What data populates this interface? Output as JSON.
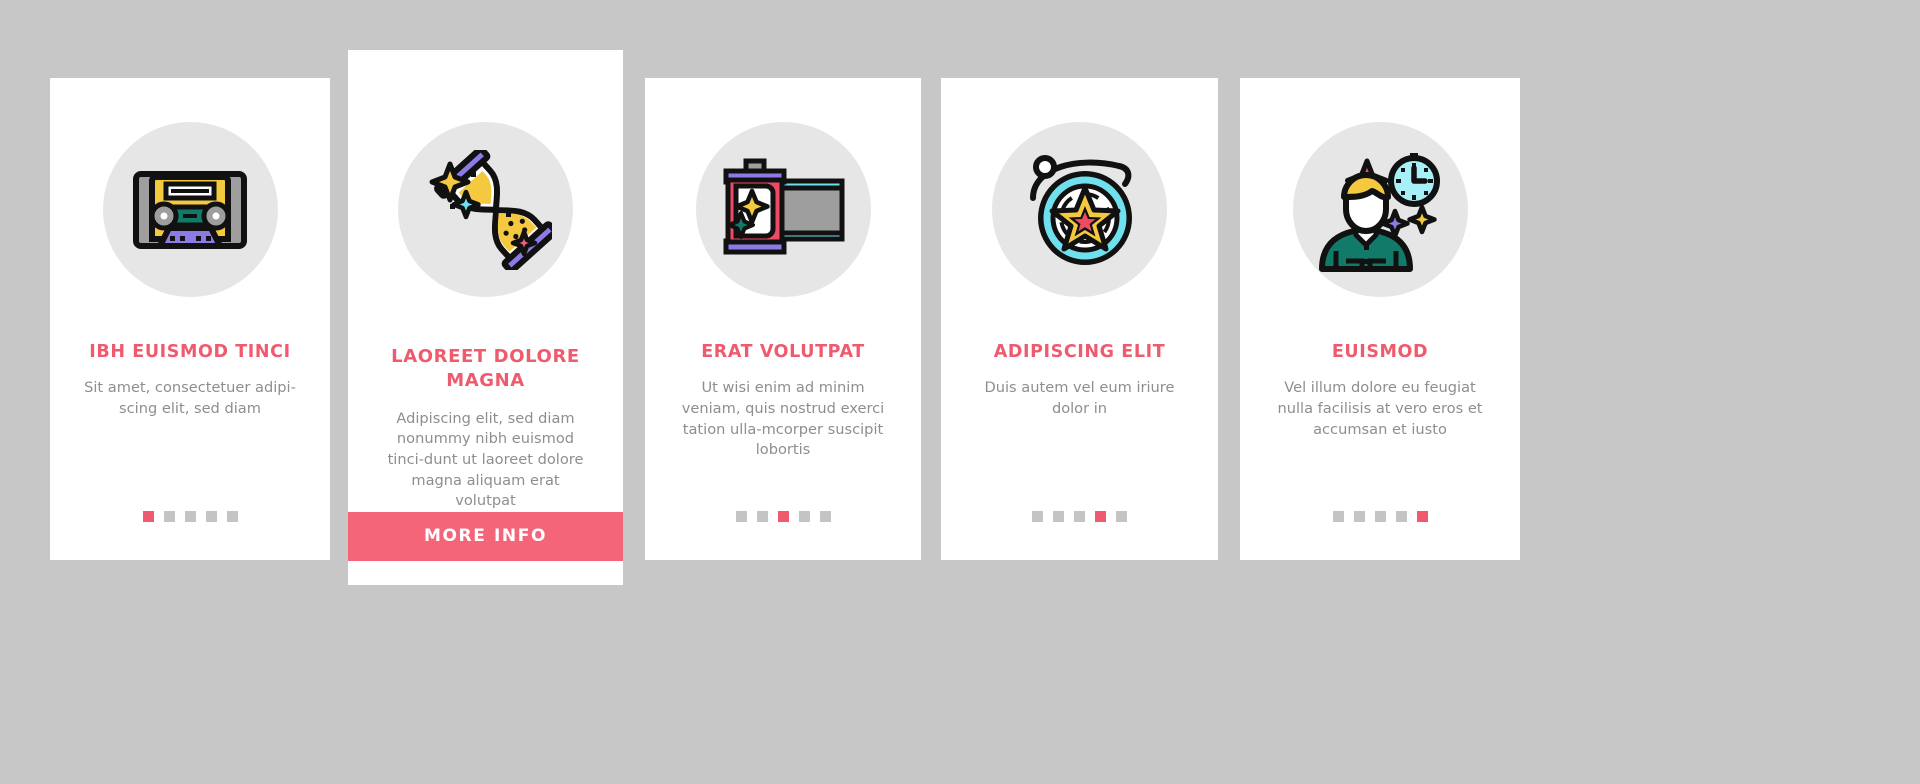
{
  "page": {
    "background_color": "#c7c7c7",
    "card_background": "#ffffff",
    "accent_color": "#ef5b6e",
    "icon_circle_color": "#e6e6e6",
    "body_text_color": "#8e8e8e",
    "dot_inactive_color": "#c4c4c4",
    "dot_active_color": "#f05a71"
  },
  "cards": [
    {
      "icon": "cassette-tape-icon",
      "title": "IBH EUISMOD TINCI",
      "body": "Sit amet, consectetuer adipi-scing elit, sed diam",
      "dots": {
        "count": 5,
        "active_index": 0
      },
      "button": null
    },
    {
      "icon": "hourglass-sparkle-icon",
      "title": "LAOREET DOLORE MAGNA",
      "body": "Adipiscing elit, sed diam nonummy nibh euismod tinci-dunt ut laoreet dolore magna aliquam erat volutpat",
      "dots": null,
      "button": {
        "label": "MORE INFO",
        "color": "#f4657a"
      }
    },
    {
      "icon": "film-canister-icon",
      "title": "ERAT VOLUTPAT",
      "body": "Ut wisi enim ad minim veniam, quis nostrud exerci tation ulla-mcorper suscipit lobortis",
      "dots": {
        "count": 5,
        "active_index": 2
      },
      "button": null
    },
    {
      "icon": "yoyo-star-icon",
      "title": "ADIPISCING ELIT",
      "body": "Duis autem vel eum iriure dolor in",
      "dots": {
        "count": 5,
        "active_index": 3
      },
      "button": null
    },
    {
      "icon": "person-clock-icon",
      "title": "EUISMOD",
      "body": "Vel illum dolore eu feugiat nulla facilisis at vero eros et accumsan et iusto",
      "dots": {
        "count": 5,
        "active_index": 4
      },
      "button": null
    }
  ]
}
